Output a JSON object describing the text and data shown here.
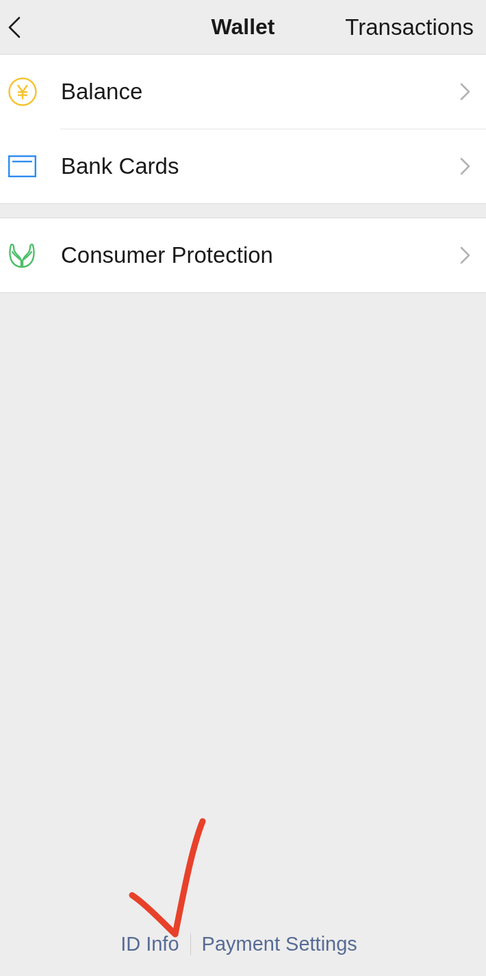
{
  "header": {
    "title": "Wallet",
    "action": "Transactions"
  },
  "groups": [
    {
      "items": [
        {
          "kind": "yen",
          "label": "Balance"
        },
        {
          "kind": "card",
          "label": "Bank Cards"
        }
      ]
    },
    {
      "items": [
        {
          "kind": "hands",
          "label": "Consumer Protection"
        }
      ]
    }
  ],
  "footer_links": [
    "ID Info",
    "Payment Settings"
  ],
  "annotation": {
    "kind": "check"
  }
}
